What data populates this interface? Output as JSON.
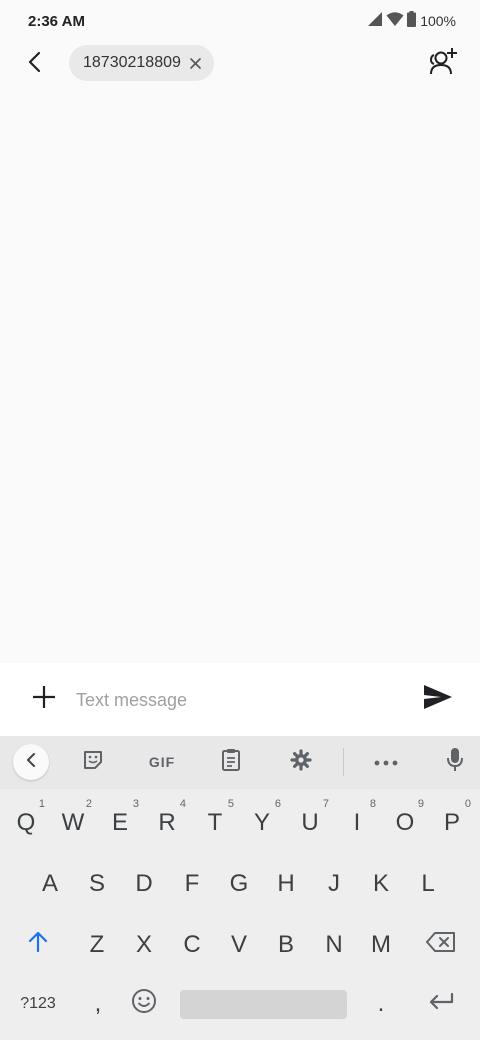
{
  "status_bar": {
    "time": "2:36 AM",
    "battery": "100%"
  },
  "header": {
    "recipient": "18730218809"
  },
  "composer": {
    "placeholder": "Text message"
  },
  "keyboard": {
    "toolbar": {
      "gif_label": "GIF"
    },
    "row1": [
      {
        "key": "Q",
        "hint": "1"
      },
      {
        "key": "W",
        "hint": "2"
      },
      {
        "key": "E",
        "hint": "3"
      },
      {
        "key": "R",
        "hint": "4"
      },
      {
        "key": "T",
        "hint": "5"
      },
      {
        "key": "Y",
        "hint": "6"
      },
      {
        "key": "U",
        "hint": "7"
      },
      {
        "key": "I",
        "hint": "8"
      },
      {
        "key": "O",
        "hint": "9"
      },
      {
        "key": "P",
        "hint": "0"
      }
    ],
    "row2": [
      "A",
      "S",
      "D",
      "F",
      "G",
      "H",
      "J",
      "K",
      "L"
    ],
    "row3": [
      "Z",
      "X",
      "C",
      "V",
      "B",
      "N",
      "M"
    ],
    "row4": {
      "symbols": "?123",
      "comma": ",",
      "period": "."
    },
    "colors": {
      "shift_accent": "#1a73e8"
    }
  }
}
